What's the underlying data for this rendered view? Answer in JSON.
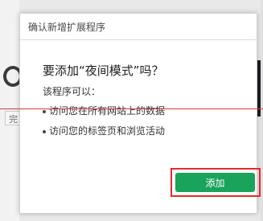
{
  "background": {
    "button_text": "完"
  },
  "dialog": {
    "title": "确认新增扩展程序",
    "question": "要添加“夜间模式”吗？",
    "permissions_intro": "该程序可以：",
    "permissions": [
      "访问您在所有网站上的数据",
      "访问您的标签页和浏览活动"
    ],
    "add_button_label": "添加"
  },
  "colors": {
    "accent_green": "#1aa35a",
    "highlight_red": "#e02b2b",
    "annotation_line_red": "#d63b3b"
  }
}
